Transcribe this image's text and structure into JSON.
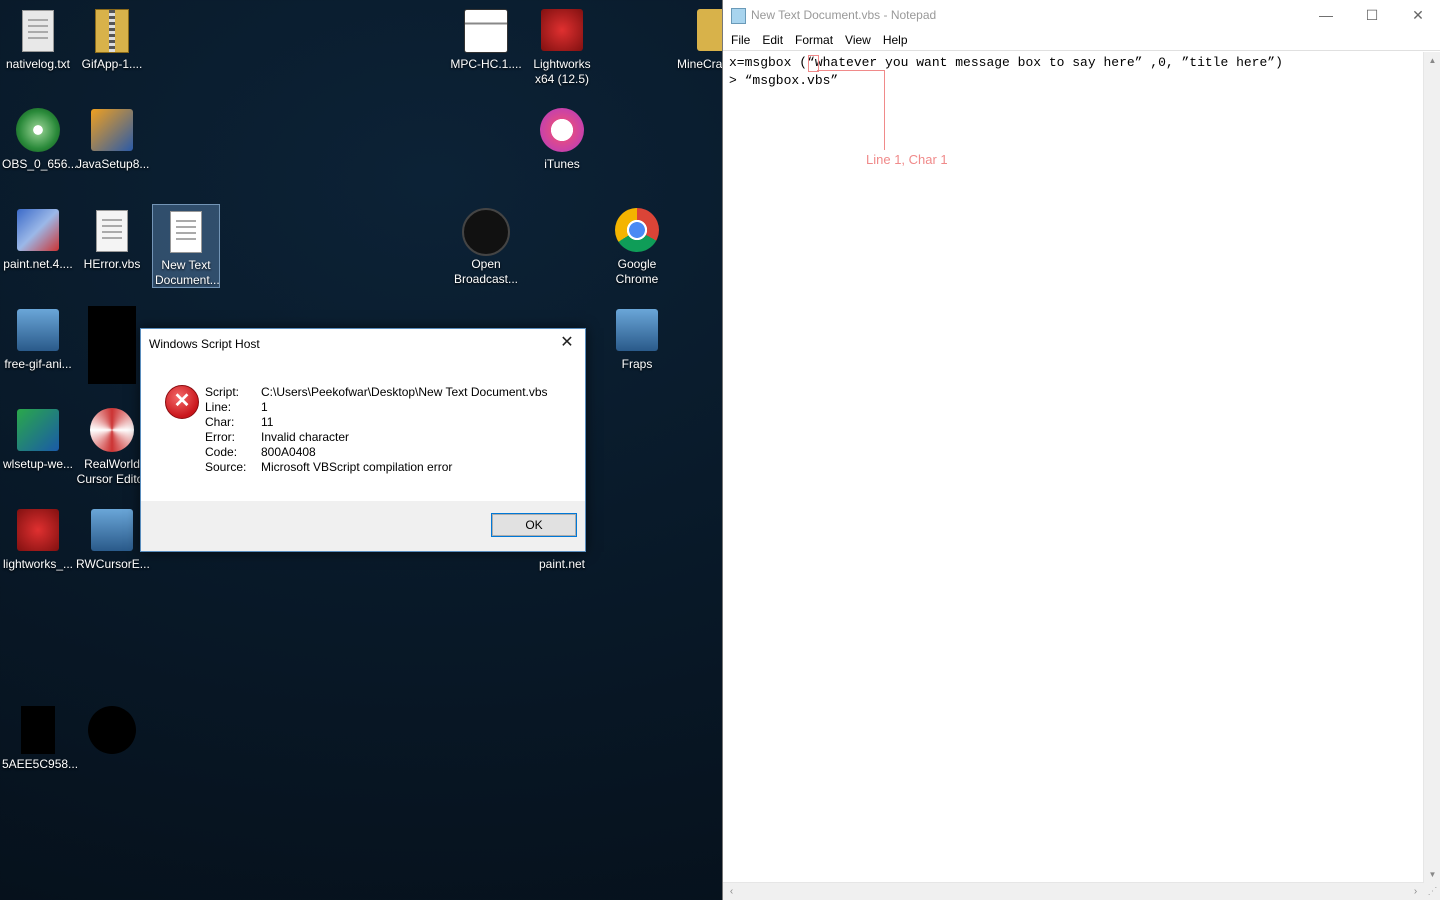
{
  "desktop": {
    "icons": [
      {
        "label": "nativelog.txt",
        "icon": "text-file-icon"
      },
      {
        "label": "GifApp-1....",
        "icon": "zip-folder-icon"
      },
      {
        "label": "OBS_0_656...",
        "icon": "installer-disc-icon"
      },
      {
        "label": "JavaSetup8...",
        "icon": "java-installer-icon"
      },
      {
        "label": "paint.net.4....",
        "icon": "paintnet-installer-icon"
      },
      {
        "label": "HError.vbs",
        "icon": "vbs-script-icon"
      },
      {
        "label": "New Text Document...",
        "icon": "vbs-script-icon"
      },
      {
        "label": "free-gif-ani...",
        "icon": "computer-installer-icon"
      },
      {
        "label": "wlsetup-we...",
        "icon": "setup-icon"
      },
      {
        "label": "RealWorld Cursor Editor",
        "icon": "cursor-editor-icon"
      },
      {
        "label": "lightworks_...",
        "icon": "lightworks-icon"
      },
      {
        "label": "RWCursorE...",
        "icon": "computer-installer-icon"
      },
      {
        "label": "5AEE5C958...",
        "icon": "black-file-icon"
      },
      {
        "label": "MPC-HC.1....",
        "icon": "mpc-hc-icon"
      },
      {
        "label": "Lightworks x64 (12.5)",
        "icon": "lightworks-icon"
      },
      {
        "label": "iTunes",
        "icon": "itunes-icon"
      },
      {
        "label": "Open Broadcast...",
        "icon": "obs-icon"
      },
      {
        "label": "Google Chrome",
        "icon": "chrome-icon"
      },
      {
        "label": "Fraps",
        "icon": "fraps-icon"
      },
      {
        "label": "paint.net",
        "icon": "paintnet-icon"
      },
      {
        "label": "MineCra...",
        "icon": "folder-icon"
      }
    ]
  },
  "dialog": {
    "title": "Windows Script Host",
    "fields": [
      {
        "key": "Script:",
        "value": "C:\\Users\\Peekofwar\\Desktop\\New Text Document.vbs"
      },
      {
        "key": "Line:",
        "value": "1"
      },
      {
        "key": "Char:",
        "value": "11"
      },
      {
        "key": "Error:",
        "value": "Invalid character"
      },
      {
        "key": "Code:",
        "value": "800A0408"
      },
      {
        "key": "Source:",
        "value": "Microsoft VBScript compilation error"
      }
    ],
    "ok_label": "OK",
    "close_glyph": "✕",
    "error_glyph": "✕"
  },
  "notepad": {
    "title": "New Text Document.vbs - Notepad",
    "menu": [
      "File",
      "Edit",
      "Format",
      "View",
      "Help"
    ],
    "lines": [
      "x=msgbox (“whatever you want message box to say here” ,0, ”title here”)",
      "> “msgbox.vbs”"
    ],
    "controls": {
      "minimize": "—",
      "maximize": "☐",
      "close": "✕"
    }
  },
  "annotation": {
    "label": "Line 1, Char 1",
    "color": "#f08a8a"
  }
}
